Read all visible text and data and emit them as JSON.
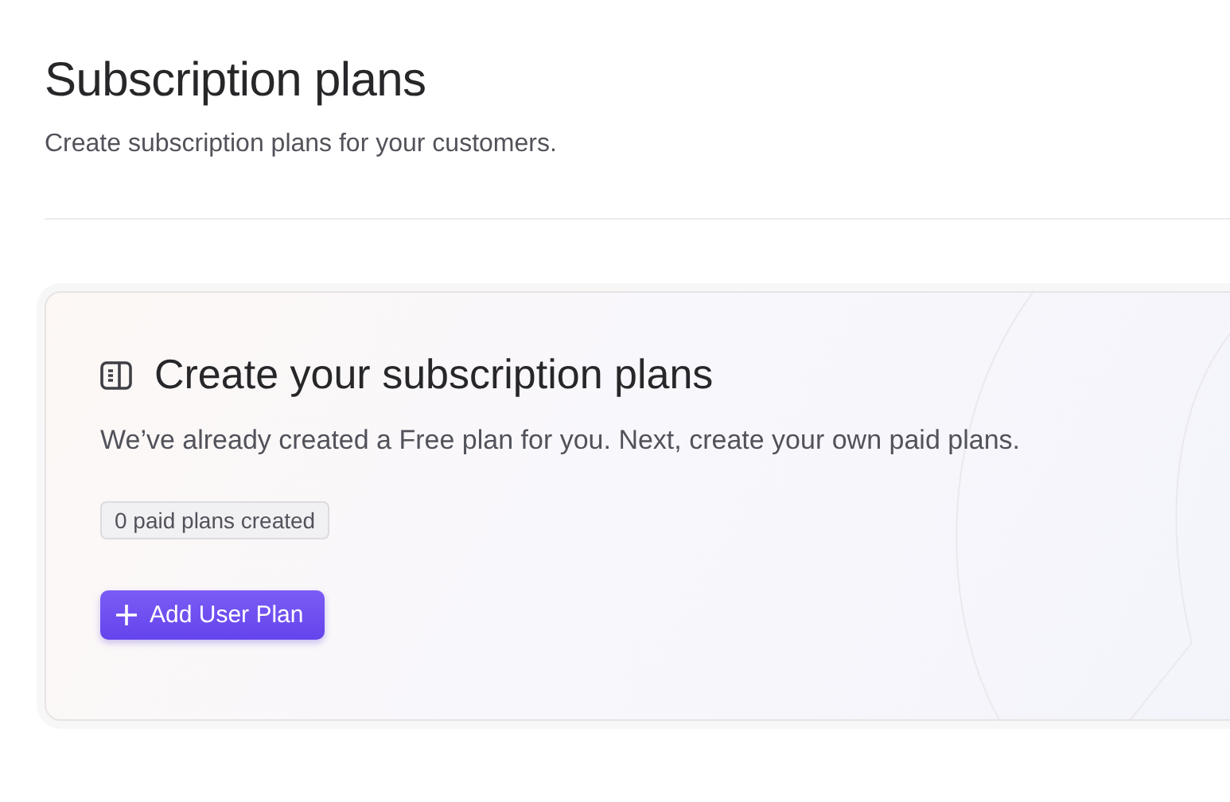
{
  "header": {
    "title": "Subscription plans",
    "subtitle": "Create subscription plans for your customers."
  },
  "card": {
    "title": "Create your subscription plans",
    "description": "We’ve already created a Free plan for you. Next, create your own paid plans.",
    "badge": "0 paid plans created",
    "button": "Add User Plan"
  }
}
